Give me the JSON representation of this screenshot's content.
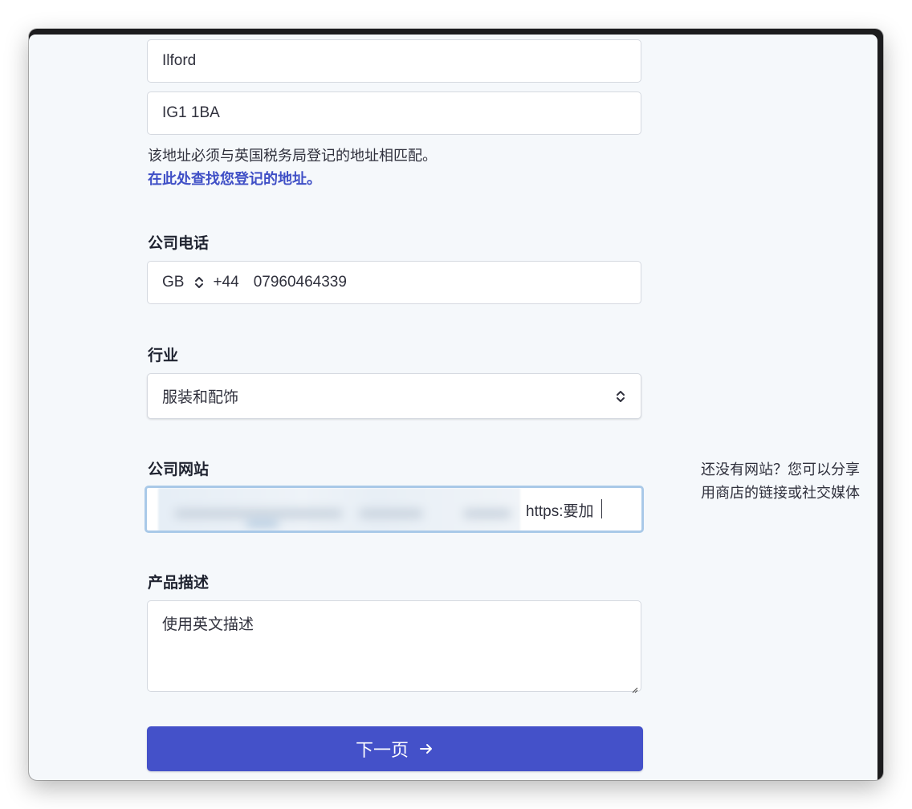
{
  "address": {
    "city_value": "Ilford",
    "postcode_value": "IG1 1BA",
    "helper_text": "该地址必须与英国税务局登记的地址相匹配。",
    "lookup_link": "在此处查找您登记的地址。"
  },
  "phone": {
    "label": "公司电话",
    "country_code": "GB",
    "dial_prefix": "+44",
    "number": "07960464339"
  },
  "industry": {
    "label": "行业",
    "selected": "服装和配饰"
  },
  "website": {
    "label": "公司网站",
    "visible_value": "https:要加",
    "side_note_line1": "还没有网站？您可以分享",
    "side_note_line2": "用商店的链接或社交媒体"
  },
  "description": {
    "label": "产品描述",
    "value": "使用英文描述"
  },
  "next_button": {
    "label": "下一页"
  },
  "colors": {
    "accent": "#4451c9",
    "link": "#3f4fc6",
    "focus_ring": "#a9c9e8",
    "background": "#f5f8fb"
  },
  "icons": {
    "phone_country_select": "chevron-up-down-icon",
    "industry_select": "chevron-up-down-icon",
    "next": "arrow-right-icon",
    "textarea_resize": "resize-grip-icon"
  }
}
